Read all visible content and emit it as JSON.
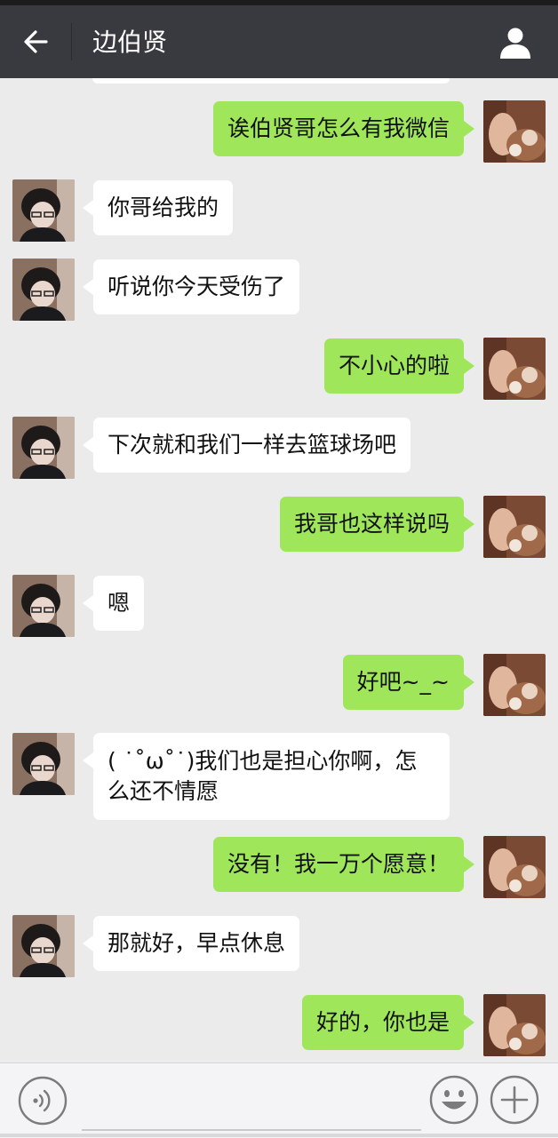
{
  "header": {
    "title": "边伯贤",
    "back_icon": "arrow-left-icon",
    "profile_icon": "person-icon"
  },
  "colors": {
    "header_bg": "#393a3f",
    "chat_bg": "#ebebeb",
    "outgoing_bubble": "#9fe65b",
    "incoming_bubble": "#ffffff"
  },
  "messages": [
    {
      "from": "me",
      "text": "诶伯贤哥怎么有我微信"
    },
    {
      "from": "contact",
      "text": "你哥给我的"
    },
    {
      "from": "contact",
      "text": "听说你今天受伤了"
    },
    {
      "from": "me",
      "text": "不小心的啦"
    },
    {
      "from": "contact",
      "text": "下次就和我们一样去篮球场吧"
    },
    {
      "from": "me",
      "text": "我哥也这样说吗"
    },
    {
      "from": "contact",
      "text": "嗯"
    },
    {
      "from": "me",
      "text": "好吧~_~"
    },
    {
      "from": "contact",
      "text": "( ˙˚ω˚˙)我们也是担心你啊，怎么还不情愿"
    },
    {
      "from": "me",
      "text": "没有！我一万个愿意！"
    },
    {
      "from": "contact",
      "text": "那就好，早点休息"
    },
    {
      "from": "me",
      "text": "好的，你也是"
    }
  ],
  "input_bar": {
    "voice_icon": "voice-icon",
    "emoji_icon": "emoji-icon",
    "plus_icon": "plus-icon",
    "value": ""
  }
}
